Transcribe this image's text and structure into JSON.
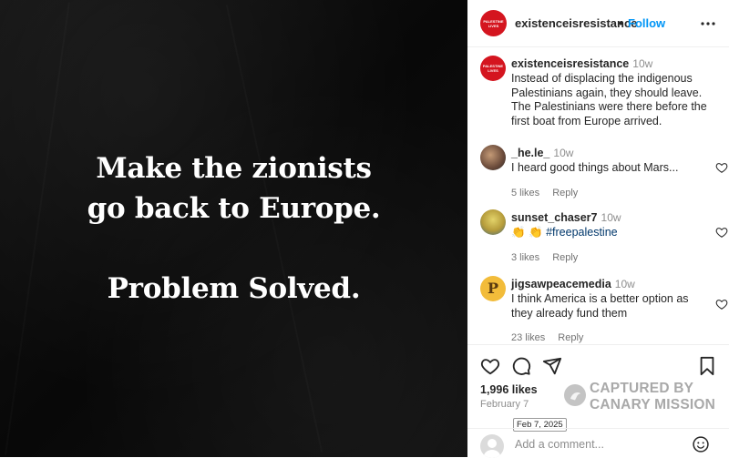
{
  "post": {
    "line1": "Make the zionists",
    "line2": "go back to Europe.",
    "line3": "Problem Solved."
  },
  "header": {
    "username": "existenceisresistance",
    "separator": "•",
    "follow_label": "Follow",
    "avatar_text": "PALESTINE LIVES",
    "more_icon": "more-horizontal-icon"
  },
  "caption": {
    "username": "existenceisresistance",
    "time": "10w",
    "text": "Instead of displacing the indigenous Palestinians again, they should leave. The Palestinians were there before the first boat from Europe arrived.",
    "avatar_text": "PALESTINE LIVES"
  },
  "comments": [
    {
      "username": "_he.le_",
      "time": "10w",
      "text": "I heard good things about Mars...",
      "likes": "5 likes",
      "reply": "Reply"
    },
    {
      "username": "sunset_chaser7",
      "time": "10w",
      "text": "👏 👏 #freepalestine",
      "likes": "3 likes",
      "reply": "Reply"
    },
    {
      "username": "jigsawpeacemedia",
      "time": "10w",
      "text": "I think America is a better option as they already fund them",
      "likes": "23 likes",
      "reply": "Reply",
      "avatar_letter": "P"
    }
  ],
  "actions": {
    "likes": "1,996 likes",
    "date": "February 7",
    "stamp": "Feb 7, 2025",
    "watermark_line1": "CAPTURED BY",
    "watermark_line2": "CANARY MISSION"
  },
  "add_comment": {
    "placeholder": "Add a comment..."
  },
  "colors": {
    "accent": "#0095f6",
    "brand_red": "#d4151f",
    "post_bg": "#0c0c0c"
  }
}
